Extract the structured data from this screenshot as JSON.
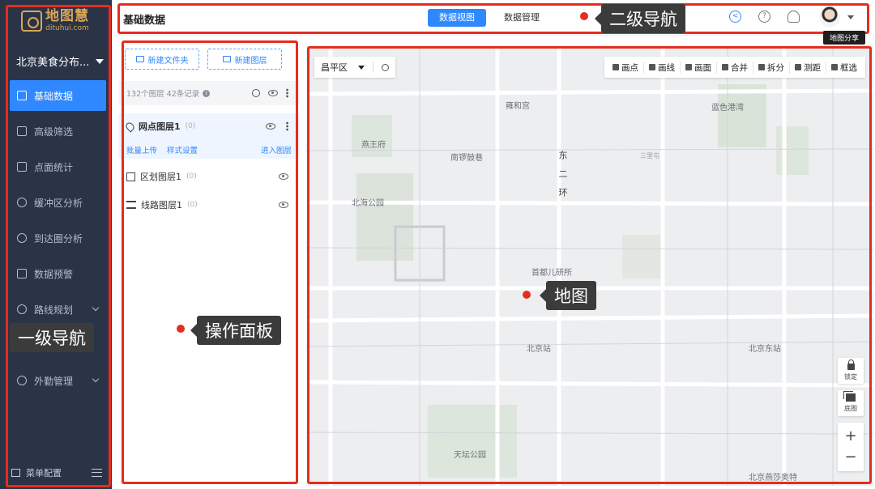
{
  "sidebar": {
    "logo_cn": "地图慧",
    "logo_en": "dituhui.com",
    "project": "北京美食分布...",
    "items": [
      {
        "label": "基础数据",
        "active": true
      },
      {
        "label": "高级筛选"
      },
      {
        "label": "点面统计"
      },
      {
        "label": "缓冲区分析"
      },
      {
        "label": "到达圈分析"
      },
      {
        "label": "数据预警"
      },
      {
        "label": "路线规划",
        "expandable": true
      },
      {
        "label": "",
        "expandable": false
      },
      {
        "label": "外勤管理",
        "expandable": true
      }
    ],
    "menu_config": "菜单配置"
  },
  "topbar": {
    "title": "基础数据",
    "tabs": [
      {
        "label": "数据视图",
        "active": true
      },
      {
        "label": "数据管理"
      }
    ],
    "tooltip": "地图分享"
  },
  "panel": {
    "new_folder": "新建文件夹",
    "new_layer": "新建图层",
    "summary": "132个图层 42条记录",
    "layers": [
      {
        "name": "网点图层1",
        "count": "(0)",
        "type": "point"
      },
      {
        "name": "区划图层1",
        "count": "(0)",
        "type": "region"
      },
      {
        "name": "线路图层1",
        "count": "(0)",
        "type": "route"
      }
    ],
    "actions": {
      "upload": "批量上传",
      "style": "样式设置",
      "goto": "进入图层"
    }
  },
  "map": {
    "district": "昌平区",
    "tools": [
      "画点",
      "画线",
      "画面",
      "合并",
      "拆分",
      "测距",
      "框选"
    ],
    "labels": [
      "雍和宫",
      "蓝色港湾",
      "燕王府",
      "南锣鼓巷",
      "三里屯",
      "北海公园",
      "首都儿研所",
      "北京站",
      "北京东站",
      "天坛公园",
      "北京燕莎奥特"
    ],
    "road_label": "东二环",
    "controls": {
      "lock": "锁定",
      "base": "底图",
      "zoom_in": "+",
      "zoom_out": "−"
    }
  },
  "annotations": {
    "primary_nav": "一级导航",
    "secondary_nav": "二级导航",
    "panel": "操作面板",
    "map": "地图",
    "color": "#e52d1f"
  }
}
